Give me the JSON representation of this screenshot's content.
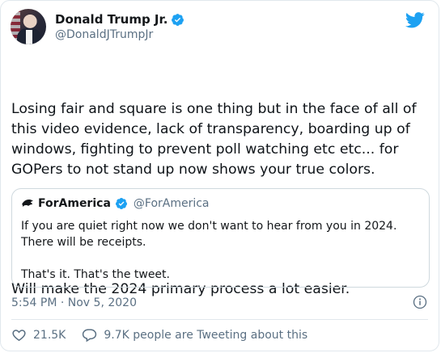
{
  "author": {
    "name": "Donald Trump Jr.",
    "handle": "@DonaldJTrumpJr",
    "verified": true
  },
  "tweet": {
    "paragraph_1": "Losing fair and square is one thing but in the face of all of this video evidence, lack of transparency, boarding up of windows, fighting to prevent poll watching etc etc... for GOPers to not stand up now shows your true colors.",
    "paragraph_2": "Will make the 2024 primary process a lot easier."
  },
  "quoted_tweet": {
    "name": "ForAmerica",
    "handle": "@ForAmerica",
    "verified": true,
    "paragraph_1": "If you are quiet right now we don't want to hear from you in 2024. There will be receipts.",
    "paragraph_2": "That's it. That's the tweet."
  },
  "timestamp": "5:54 PM · Nov 5, 2020",
  "stats": {
    "likes": "21.5K",
    "conversation": "9.7K people are Tweeting about this"
  },
  "icons": {
    "brand": "twitter-bird-icon",
    "verified": "verified-badge-icon",
    "info": "info-icon",
    "like": "heart-icon",
    "reply": "speech-bubble-icon"
  },
  "colors": {
    "twitter_blue": "#1da1f2",
    "secondary_text": "#5b7083",
    "border": "#e1e8ed"
  }
}
